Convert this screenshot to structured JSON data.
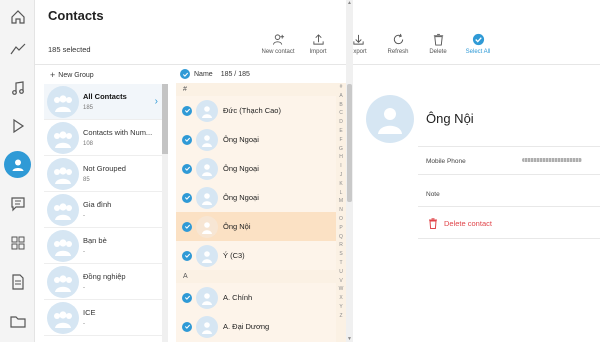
{
  "app": {
    "title": "Contacts",
    "selected_text": "185 selected"
  },
  "rail": {
    "icons": [
      "home-icon",
      "signal-icon",
      "music-icon",
      "play-icon",
      "contacts-icon",
      "message-icon",
      "apps-icon",
      "document-icon",
      "folder-icon"
    ],
    "active": "contacts-icon"
  },
  "toolbar": [
    {
      "label": "New contact",
      "icon": "add-user-icon"
    },
    {
      "label": "Import",
      "icon": "upload-icon"
    },
    {
      "label": "Export",
      "icon": "download-icon"
    },
    {
      "label": "Refresh",
      "icon": "refresh-icon"
    },
    {
      "label": "Delete",
      "icon": "trash-icon"
    },
    {
      "label": "Select All",
      "icon": "check-circle-icon"
    }
  ],
  "groups_panel": {
    "new_group_label": "New Group",
    "items": [
      {
        "name": "All Contacts",
        "count": "185",
        "active": true
      },
      {
        "name": "Contacts with Num...",
        "count": "108"
      },
      {
        "name": "Not Grouped",
        "count": "85"
      },
      {
        "name": "Gia đình",
        "count": "-"
      },
      {
        "name": "Bạn bè",
        "count": "-"
      },
      {
        "name": "Đồng nghiệp",
        "count": "-"
      },
      {
        "name": "ICE",
        "count": "-"
      }
    ]
  },
  "list": {
    "header_name": "Name",
    "header_count": "185 / 185",
    "sections": [
      {
        "letter": "#",
        "contacts": [
          "Đức (Thạch Cao)",
          "Ông Ngoại",
          "Ông Ngoại",
          "Ông Ngoại",
          "Ông Nội",
          "Ý (C3)"
        ]
      },
      {
        "letter": "A",
        "contacts": [
          "A. Chính",
          "A. Đại Dương"
        ]
      }
    ],
    "highlighted": "Ông Nội",
    "alphabet": [
      "#",
      "A",
      "B",
      "C",
      "D",
      "E",
      "F",
      "G",
      "H",
      "I",
      "J",
      "K",
      "L",
      "M",
      "N",
      "O",
      "P",
      "Q",
      "R",
      "S",
      "T",
      "U",
      "V",
      "W",
      "X",
      "Y",
      "Z"
    ]
  },
  "detail": {
    "name": "Ông Nội",
    "mobile_label": "Mobile Phone",
    "note_label": "Note",
    "delete_label": "Delete contact"
  },
  "colors": {
    "accent": "#2f9ad6",
    "highlight": "#fbe1c4",
    "delete": "#e0454a"
  }
}
